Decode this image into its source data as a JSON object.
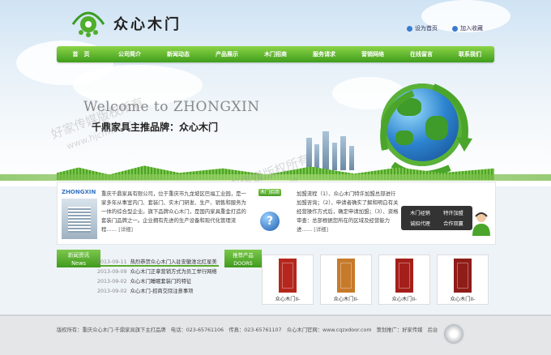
{
  "brand": {
    "name": "众心木门"
  },
  "toplinks": [
    {
      "label": "设为首页"
    },
    {
      "label": "加入收藏"
    }
  ],
  "nav": [
    "首　页",
    "公司简介",
    "新闻动态",
    "产品展示",
    "木门招商",
    "服务请求",
    "营销网络",
    "在线留言",
    "联系我们"
  ],
  "hero": {
    "welcome": "Welcome to ZHONGXIN",
    "slogan": "千鼎家具主推品牌：众心木门"
  },
  "watermark": [
    "好家传媒版权所有",
    "www.hjcmw.net"
  ],
  "info": {
    "logo_text": "ZHONGXIN",
    "intro": "重庆千鼎家具有限公司，位于重庆市九龙坡区巴福工业园，是一家多年从事室内门、套装门、实木门研发、生产、销售和服务为一体的综合型企业。旗下品牌众心木门，是国内家具重金打造的套装门品牌之一。企业拥有先进的生产设备和现代化管理流程……",
    "intro_more": "[详细]",
    "tab": "木门招商",
    "flow": "加盟流程（1）、众心木门特许加盟总部进行加盟咨询；（2）、申请者确实了解和明白有关经营操作方式后，确定申请加盟；（3）、资格审查：总部根据您所在的区域及经营能力进……",
    "flow_more": "[详细]",
    "buttons": [
      "木门经销",
      "特许加盟",
      "诚招代理",
      "合作双赢"
    ]
  },
  "news": {
    "tab_cn": "新闻资讯",
    "tab_en": "News",
    "items": [
      {
        "date": "2013-09-11",
        "title": "热烈恭贺众心木门入驻安徽淮北红星美"
      },
      {
        "date": "2013-09-09",
        "title": "众心木门正拿营销方式为员工举行网络"
      },
      {
        "date": "2013-09-02",
        "title": "众心木门睡眠套装门的特征"
      },
      {
        "date": "2013-09-02",
        "title": "众心木门-招商交际注意事项"
      }
    ]
  },
  "products": {
    "tab_cn": "推荐产品",
    "tab_en": "DOORS",
    "items": [
      {
        "caption": "众心木门II-",
        "color": "#b5261c"
      },
      {
        "caption": "众心木门II-",
        "color": "#c77a2a"
      },
      {
        "caption": "众心木门II-",
        "color": "#a51f1a"
      },
      {
        "caption": "众心木门II-",
        "color": "#8f1c18"
      }
    ]
  },
  "footer": {
    "text": "版权所有：重庆众心木门-千鼎家具旗下主打品牌　电话：023-65761106　传真：023-65761107　众心木门官网：www.cqzxdoor.com　策划推广：好家传媒　后台"
  },
  "colors": {
    "nav_green": "#4ea622",
    "accent_blue": "#3574c4"
  }
}
